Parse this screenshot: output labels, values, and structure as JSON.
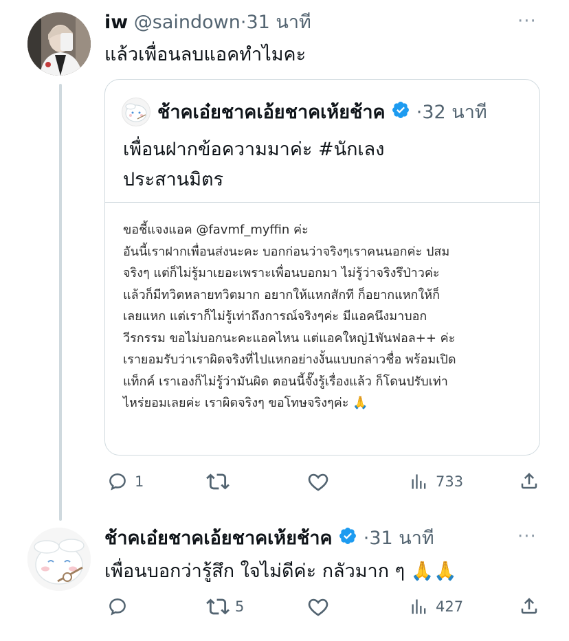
{
  "tweet1": {
    "display_name": "iw",
    "handle": "@saindown",
    "separator": "·",
    "time": "31 นาที",
    "text": "แล้วเพื่อนลบแอคทำไมคะ",
    "more": "···",
    "quoted": {
      "display_name": "ช้าคเอ๋ยชาคเอ้ยชาคเห้ยช้าค",
      "separator": "·",
      "time": "32 นาที",
      "text_line1": "เพื่อนฝากข้อความมาค่ะ #นักเลง",
      "text_line2": "ประสานมิตร",
      "note_lines": [
        "ขอชี้แจงแอค @favmf_myffin ค่ะ",
        "อันนี้เราฝากเพื่อนส่งนะคะ บอกก่อนว่าจริงๆเราคนนอกค่ะ ปสม",
        "จริงๆ แต่ก็ไม่รู้มาเยอะเพราะเพื่อนบอกมา ไม่รู้ว่าจริงรึป่าวค่ะ",
        "แล้วก็มีทวิตหลายทวิตมาก อยากให้แหกสักที ก็อยากแหกให้ก็",
        "เลยแหก แต่เราก็ไม่รู้เท่าถึงการณ์จริงๆค่ะ มีแอคนึงมาบอก",
        "วีรกรรม ขอไม่บอกนะคะแอคไหน แต่แอคใหญ่1พันฟอล++ ค่ะ",
        "เรายอมรับว่าเราผิดจริงที่ไปแหกอย่างงั้นแบบกล่าวชื่อ พร้อมเปิด",
        "แท็กค์ เราเองก็ไม่รู้ว่ามันผิด ตอนนี้จั๊งรู้เรื่องแล้ว ก็โดนปรับเท่า",
        "ไหร่ยอมเลยค่ะ เราผิดจริงๆ ขอโทษจริงๆค่ะ 🙏"
      ]
    },
    "actions": {
      "replies": "1",
      "retweets": "",
      "likes": "",
      "views": "733"
    }
  },
  "tweet2": {
    "display_name": "ช้าคเอ๋ยชาคเอ้ยชาคเห้ยช้าค",
    "separator": "·",
    "time": "31 นาที",
    "text": "เพื่อนบอกว่ารู้สึก ใจไม่ดีค่ะ กลัวมาก ๆ 🙏🙏",
    "more": "···",
    "actions": {
      "replies": "",
      "retweets": "5",
      "likes": "",
      "views": "427"
    }
  },
  "colors": {
    "verified": "#1d9bf0",
    "muted": "#536471",
    "line": "#cfd9de"
  }
}
